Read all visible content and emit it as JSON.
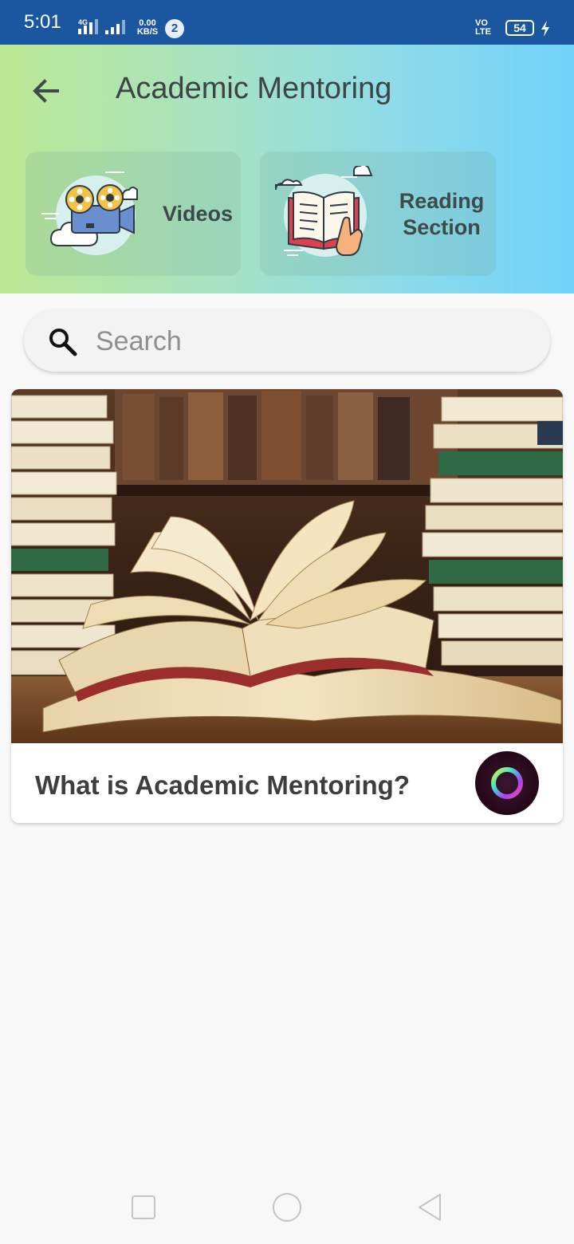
{
  "status_bar": {
    "time": "5:01",
    "network_type": "4G",
    "data_speed_value": "0.00",
    "data_speed_unit": "KB/S",
    "notification_count": "2",
    "volte_top": "VO",
    "volte_bottom": "LTE",
    "battery_level": "54"
  },
  "header": {
    "title": "Academic Mentoring",
    "categories": [
      {
        "label": "Videos",
        "icon": "video-camera-icon"
      },
      {
        "label": "Reading Section",
        "icon": "open-book-icon"
      }
    ]
  },
  "search": {
    "placeholder": "Search",
    "value": ""
  },
  "articles": [
    {
      "title": "What is Academic Mentoring?",
      "image": "open-books-photo"
    }
  ],
  "colors": {
    "status_bar": "#1b56a0",
    "header_gradient_start": "#bde893",
    "header_gradient_end": "#71d2f9",
    "background": "#f8f8f8"
  },
  "nav": {
    "buttons": [
      "recent-apps",
      "home",
      "back"
    ]
  }
}
